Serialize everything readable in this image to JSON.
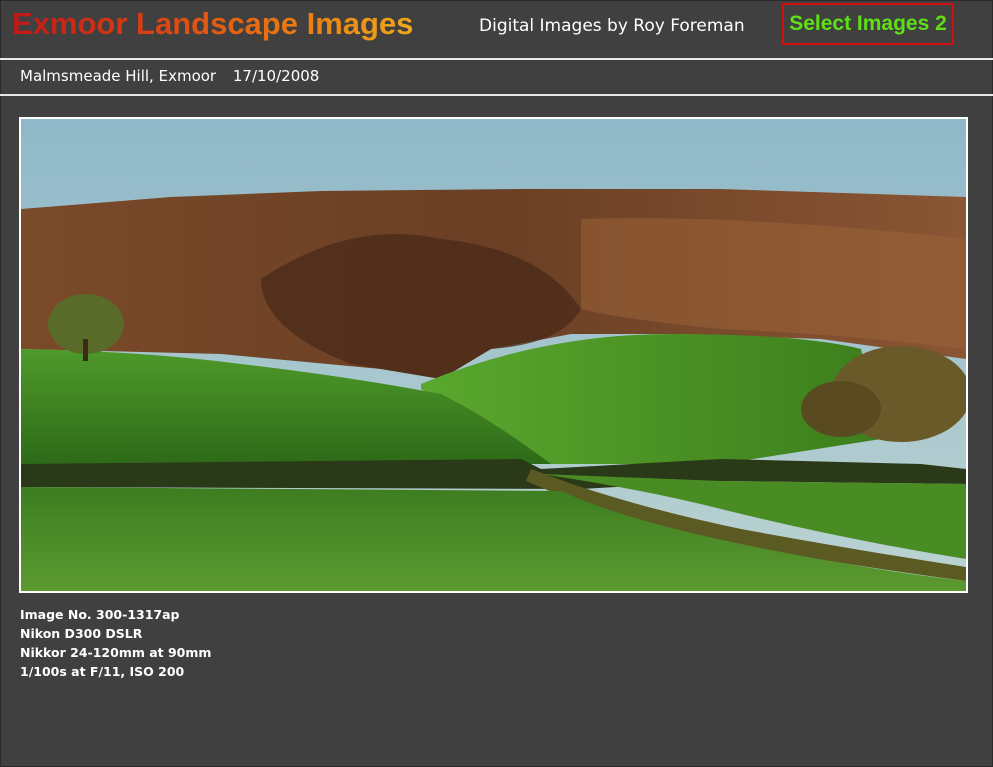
{
  "header": {
    "site_title": "Exmoor Landscape Images",
    "byline": "Digital Images by Roy Foreman",
    "select_button": "Select Images 2"
  },
  "caption": {
    "location": "Malmsmeade Hill, Exmoor",
    "date": "17/10/2008"
  },
  "photo": {
    "subject": "landscape-photo"
  },
  "details": [
    "Image No. 300-1317ap",
    "Nikon D300 DSLR",
    "Nikkor 24-120mm at 90mm",
    "1/100s at F/11,  ISO 200"
  ],
  "colors": {
    "background": "#404040",
    "title_gradient_start": "#c01818",
    "title_gradient_end": "#f0a81a",
    "select_text": "#5fe015",
    "select_border": "#d01010"
  }
}
